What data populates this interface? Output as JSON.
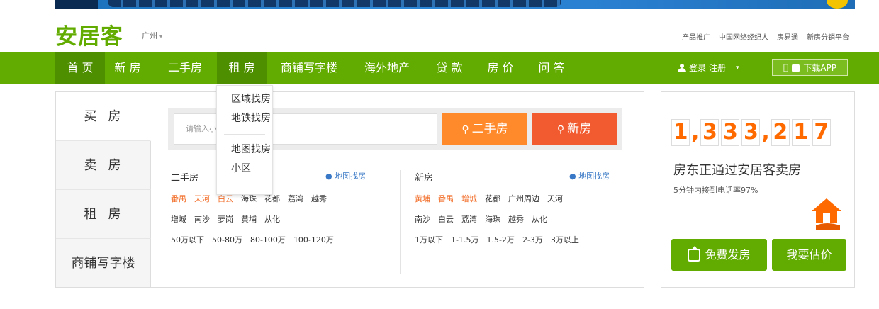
{
  "header": {
    "logo": "安居客",
    "city": "广州",
    "city_caret": "▾",
    "toplinks": [
      "产品推广",
      "中国网络经纪人",
      "房易通",
      "新房分销平台"
    ]
  },
  "nav": {
    "items": [
      "首 页",
      "新 房",
      "二手房",
      "租 房",
      "商铺写字楼",
      "海外地产",
      "贷 款",
      "房 价",
      "问 答"
    ],
    "login": "登录",
    "register": "注册",
    "login_caret": "▾",
    "app_label": "下载APP"
  },
  "dropdown": {
    "items": [
      "区域找房",
      "地铁找房",
      "地图找房",
      "小区"
    ]
  },
  "tabs": [
    "买房",
    "卖房",
    "租房",
    "商铺写字楼"
  ],
  "search": {
    "placeholder": "请输入小区名或地址",
    "btn_ershou": "二手房",
    "btn_xinfang": "新房",
    "search_glyph": "⚲"
  },
  "ershou": {
    "title": "二手房",
    "map_link": "地图找房",
    "districts_row1": [
      "番禺",
      "天河",
      "白云",
      "海珠",
      "花都",
      "荔湾",
      "越秀"
    ],
    "districts_row2": [
      "增城",
      "南沙",
      "萝岗",
      "黄埔",
      "从化"
    ],
    "prices": [
      "50万以下",
      "50-80万",
      "80-100万",
      "100-120万"
    ]
  },
  "xinfang": {
    "title": "新房",
    "map_link": "地图找房",
    "districts_row1": [
      "黄埔",
      "番禺",
      "增城",
      "花都",
      "广州周边",
      "天河"
    ],
    "districts_row2": [
      "南沙",
      "白云",
      "荔湾",
      "海珠",
      "越秀",
      "从化"
    ],
    "prices": [
      "1万以下",
      "1-1.5万",
      "1.5-2万",
      "2-3万",
      "3万以上"
    ]
  },
  "side": {
    "digits": [
      "1",
      ",",
      "3",
      "3",
      "3",
      ",",
      "2",
      "1",
      "7"
    ],
    "title": "房东正通过安居客卖房",
    "subtitle": "5分钟内接到电话率97%",
    "btn_free": "免费发房",
    "btn_estimate": "我要估价"
  },
  "colors": {
    "brand_green": "#62ab00",
    "orange": "#ff8a2c",
    "red_orange": "#f25a2f",
    "counter_orange": "#ff6a00"
  }
}
